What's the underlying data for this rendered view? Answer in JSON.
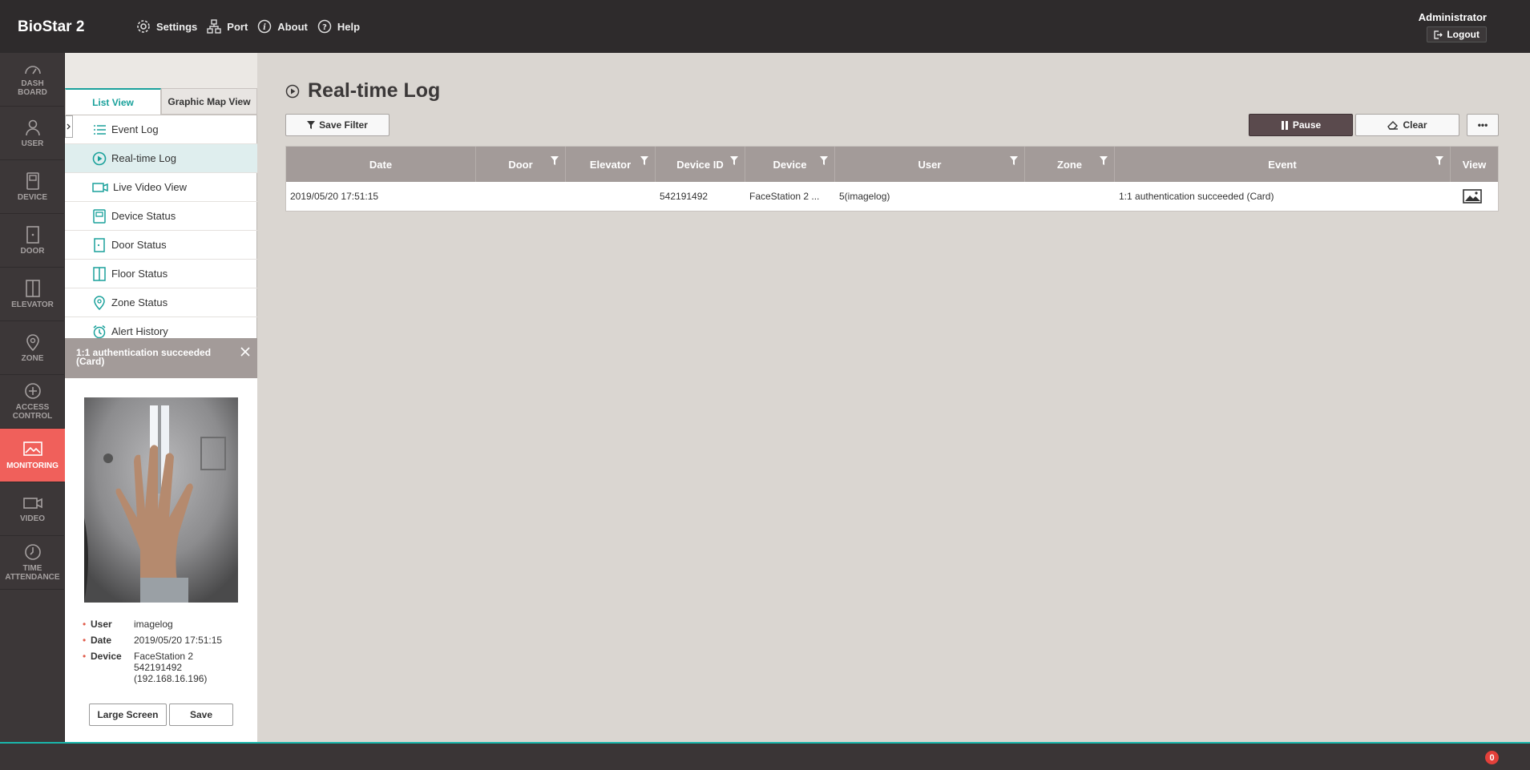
{
  "app": {
    "brand": "BioStar 2"
  },
  "topnav": [
    {
      "label": "Settings",
      "icon": "gear-icon"
    },
    {
      "label": "Port",
      "icon": "network-icon"
    },
    {
      "label": "About",
      "icon": "info-icon"
    },
    {
      "label": "Help",
      "icon": "help-icon"
    }
  ],
  "account": {
    "name": "Administrator",
    "logout": "Logout"
  },
  "sidebar": [
    {
      "label": "DASH BOARD",
      "icon": "dashboard-icon"
    },
    {
      "label": "USER",
      "icon": "user-icon"
    },
    {
      "label": "DEVICE",
      "icon": "device-icon"
    },
    {
      "label": "DOOR",
      "icon": "door-icon"
    },
    {
      "label": "ELEVATOR",
      "icon": "elevator-icon"
    },
    {
      "label": "ZONE",
      "icon": "zone-icon"
    },
    {
      "label": "ACCESS CONTROL",
      "icon": "access-control-icon"
    },
    {
      "label": "MONITORING",
      "icon": "monitoring-icon",
      "active": true
    },
    {
      "label": "VIDEO",
      "icon": "video-icon"
    },
    {
      "label": "TIME ATTENDANCE",
      "icon": "clock-icon"
    }
  ],
  "panel": {
    "tabs": [
      "List View",
      "Graphic Map View"
    ],
    "menu": [
      "Event Log",
      "Real-time Log",
      "Live Video View",
      "Device Status",
      "Door Status",
      "Floor Status",
      "Zone Status",
      "Alert History"
    ]
  },
  "popup": {
    "title": "1:1 authentication succeeded (Card)",
    "user_label": "User",
    "user": "imagelog",
    "date_label": "Date",
    "date": "2019/05/20 17:51:15",
    "device_label": "Device",
    "device_name": "FaceStation 2",
    "device_id": "542191492",
    "device_ip": "(192.168.16.196)",
    "large_screen": "Large Screen",
    "save": "Save"
  },
  "main": {
    "title": "Real-time Log",
    "save_filter": "Save Filter",
    "pause": "Pause",
    "clear": "Clear",
    "more": "•••"
  },
  "grid": {
    "columns": [
      "Date",
      "Door",
      "Elevator",
      "Device ID",
      "Device",
      "User",
      "Zone",
      "Event",
      "View"
    ],
    "rows": [
      [
        "2019/05/20 17:51:15",
        "",
        "",
        "542191492",
        "FaceStation 2 ...",
        "5(imagelog)",
        "",
        "1:1 authentication succeeded (Card)",
        ""
      ]
    ]
  },
  "footer": {
    "alert_count": "0"
  },
  "colors": {
    "accent": "#1aa19b",
    "active_nav": "#f0605b",
    "header": "#2e2b2c",
    "grid_header": "#a39b99"
  }
}
